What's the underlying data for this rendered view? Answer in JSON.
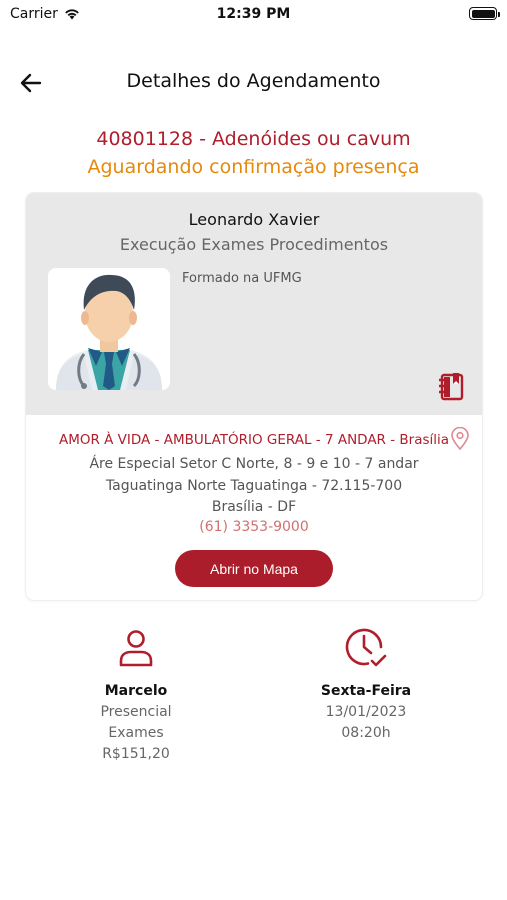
{
  "status_bar": {
    "carrier": "Carrier",
    "time": "12:39 PM",
    "battery_level": 1.0
  },
  "nav": {
    "title": "Detalhes do Agendamento",
    "back_icon": "arrow-left-icon"
  },
  "exam": {
    "title": "40801128 - Adenóides ou cavum",
    "status": "Aguardando confirmação presença",
    "title_color": "#b01e2c",
    "status_color": "#e58a0c"
  },
  "doctor": {
    "name": "Leonardo Xavier",
    "role": "Execução Exames Procedimentos",
    "bio": "Formado na UFMG",
    "avatar_icon": "doctor-avatar",
    "notebook_icon": "notebook-icon"
  },
  "clinic": {
    "name": "AMOR À VIDA - AMBULATÓRIO GERAL - 7 ANDAR - Brasília",
    "address_line1": "Áre Especial Setor C Norte, 8 - 9 e 10 - 7 andar",
    "address_line2": "Taguatinga Norte Taguatinga - 72.115-700",
    "address_line3": "Brasília - DF",
    "phone": "(61) 3353-9000",
    "map_button": "Abrir no Mapa",
    "pin_icon": "location-pin-icon",
    "accent_color": "#ab1d2a"
  },
  "patient": {
    "name": "Marcelo",
    "type": "Presencial",
    "category": "Exames",
    "price": "R$151,20",
    "icon": "person-icon"
  },
  "schedule": {
    "weekday": "Sexta-Feira",
    "date": "13/01/2023",
    "time": "08:20h",
    "icon": "clock-check-icon"
  }
}
